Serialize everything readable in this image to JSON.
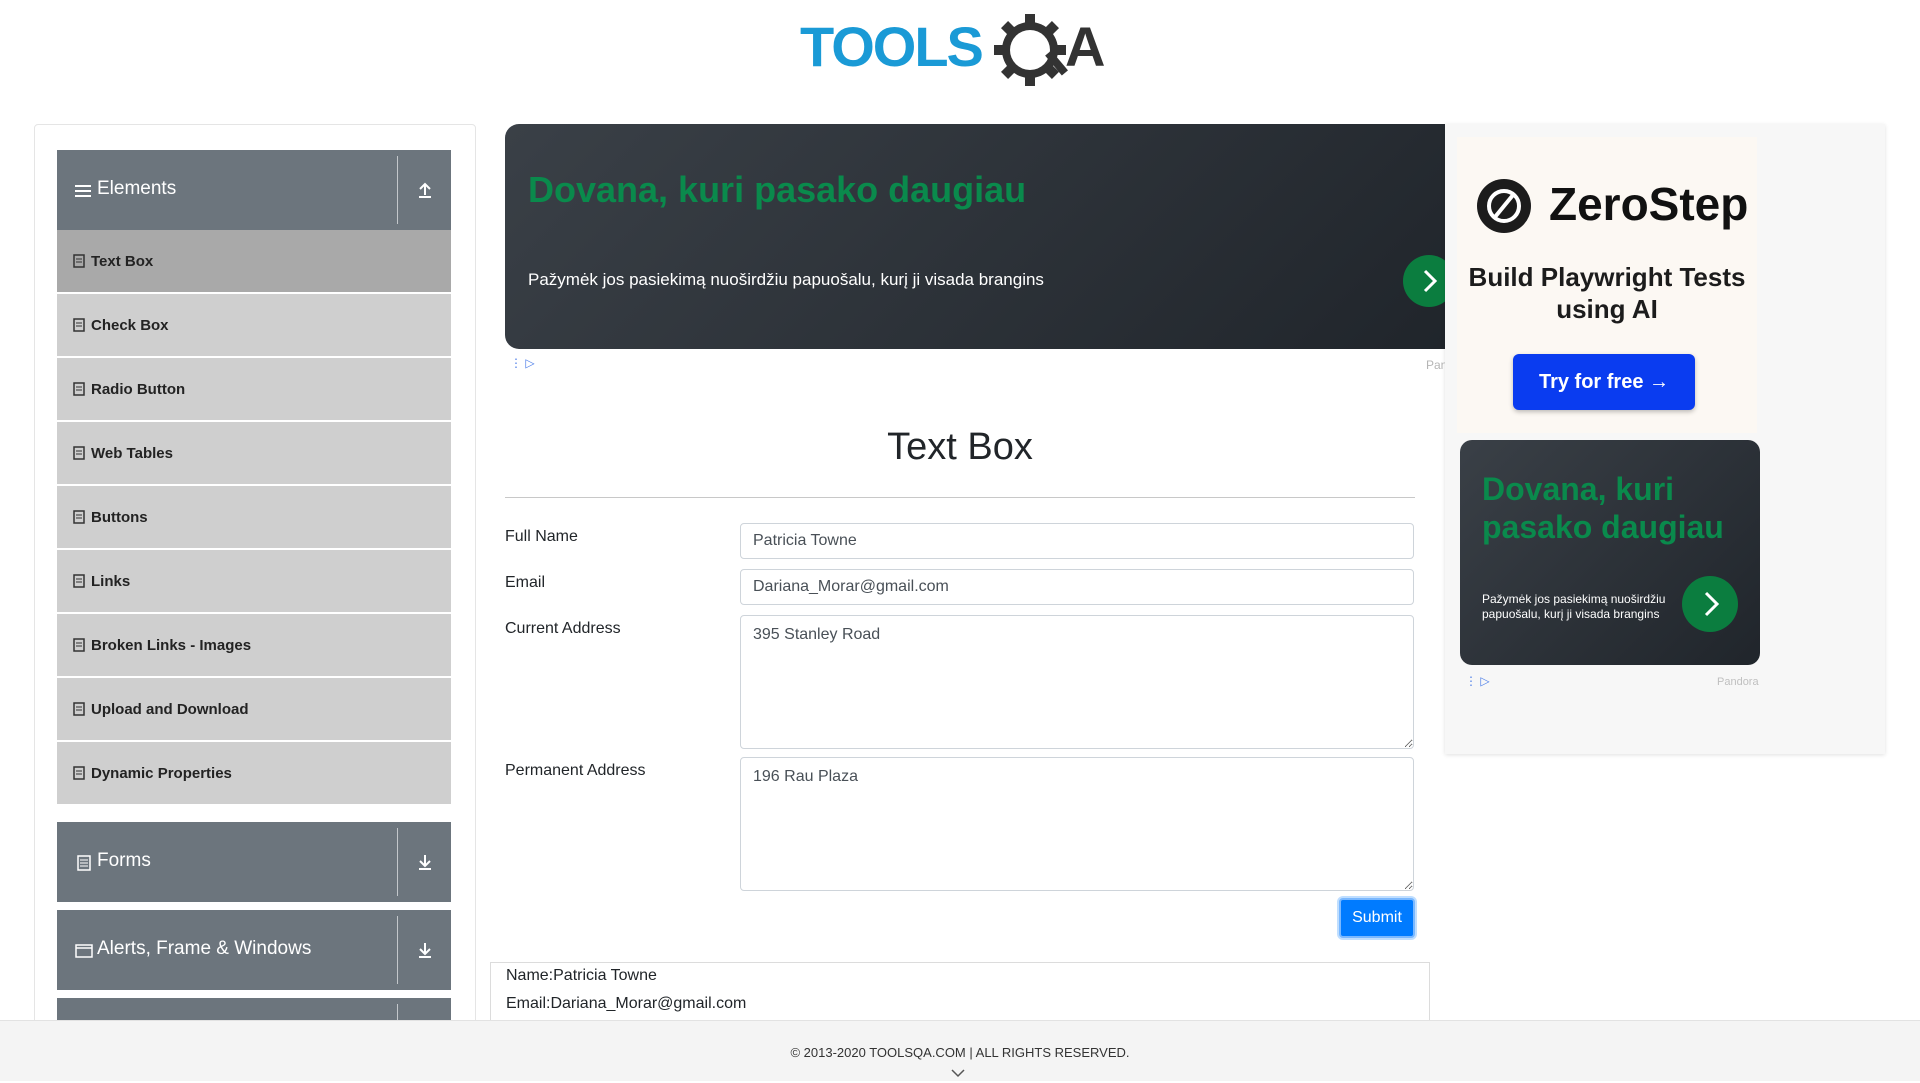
{
  "header": {
    "logo_alt": "TOOLSQA"
  },
  "sidebar": {
    "groups": [
      {
        "title": "Elements",
        "icon": "menu-icon",
        "expanded": true,
        "items": [
          {
            "label": "Text Box",
            "active": true
          },
          {
            "label": "Check Box"
          },
          {
            "label": "Radio Button"
          },
          {
            "label": "Web Tables"
          },
          {
            "label": "Buttons"
          },
          {
            "label": "Links"
          },
          {
            "label": "Broken Links - Images"
          },
          {
            "label": "Upload and Download"
          },
          {
            "label": "Dynamic Properties"
          }
        ]
      },
      {
        "title": "Forms",
        "icon": "document-icon",
        "expanded": false
      },
      {
        "title": "Alerts, Frame & Windows",
        "icon": "window-icon",
        "expanded": false
      }
    ]
  },
  "ad_top": {
    "headline": "Dovana, kuri pasako daugiau",
    "text": "Pažymėk jos pasiekimą nuoširdžiu papuošalu, kurį ji visada brangins",
    "source": "Pan"
  },
  "ad_right": {
    "brand": "ZeroStep",
    "tagline": "Build Playwright Tests using AI",
    "cta": "Try for free →",
    "gift_headline": "Dovana, kuri pasako daugiau",
    "gift_text": "Pažymėk jos pasiekimą nuoširdžiu papuošalu, kurį ji visada brangins",
    "source": "Pandora"
  },
  "page": {
    "title": "Text Box"
  },
  "form": {
    "full_name_label": "Full Name",
    "full_name_value": "Patricia Towne",
    "email_label": "Email",
    "email_value": "Dariana_Morar@gmail.com",
    "current_address_label": "Current Address",
    "current_address_value": "395 Stanley Road",
    "permanent_address_label": "Permanent Address",
    "permanent_address_value": "196 Rau Plaza",
    "submit_label": "Submit"
  },
  "output": {
    "name": "Name:Patricia Towne",
    "email": "Email:Dariana_Morar@gmail.com"
  },
  "footer": {
    "text": "© 2013-2020 TOOLSQA.COM | ALL RIGHTS RESERVED."
  },
  "colors": {
    "sidebar_header": "#6c757d",
    "menu_item": "#cfcfcf",
    "menu_item_active": "#a9a9a9",
    "primary": "#007bff",
    "ad_green": "#0a8a4c",
    "logo_blue": "#1a9ad6"
  }
}
